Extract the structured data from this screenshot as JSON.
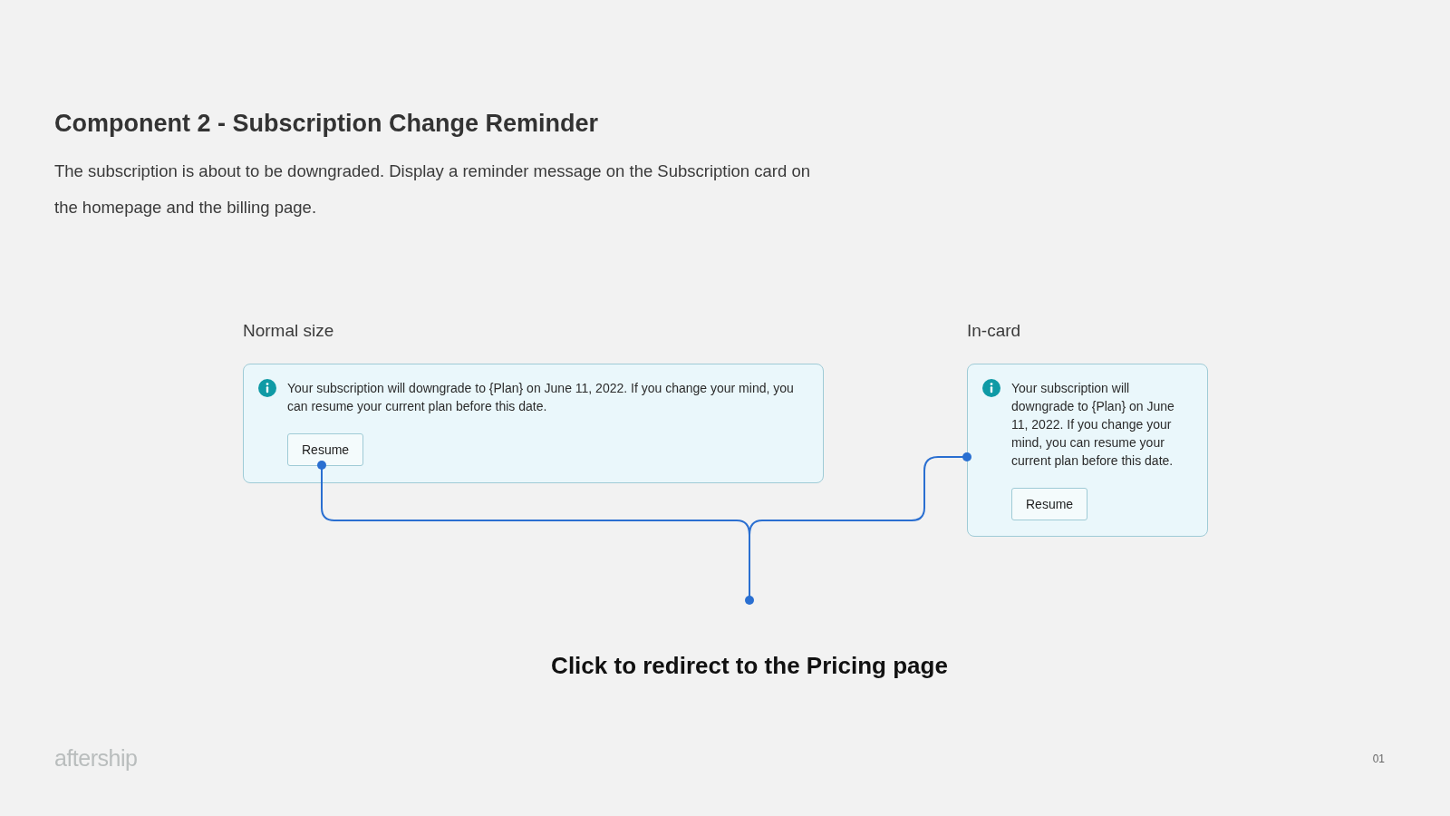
{
  "title": "Component 2 - Subscription Change Reminder",
  "description": "The subscription is about to be downgraded. Display a reminder message on the Subscription card on the homepage and the billing page.",
  "variants": [
    {
      "kind": "normal",
      "label": "Normal size",
      "message": "Your subscription will downgrade to {Plan} on June 11, 2022. If you change your mind, you can resume your current plan before this date.",
      "button": "Resume"
    },
    {
      "kind": "in_card",
      "label": "In-card",
      "message": "Your subscription will downgrade to {Plan} on June 11, 2022. If you change your mind, you can resume your current plan before this date.",
      "button": "Resume"
    }
  ],
  "callout": "Click to redirect to the Pricing page",
  "logo": "aftership",
  "page_number": "01"
}
